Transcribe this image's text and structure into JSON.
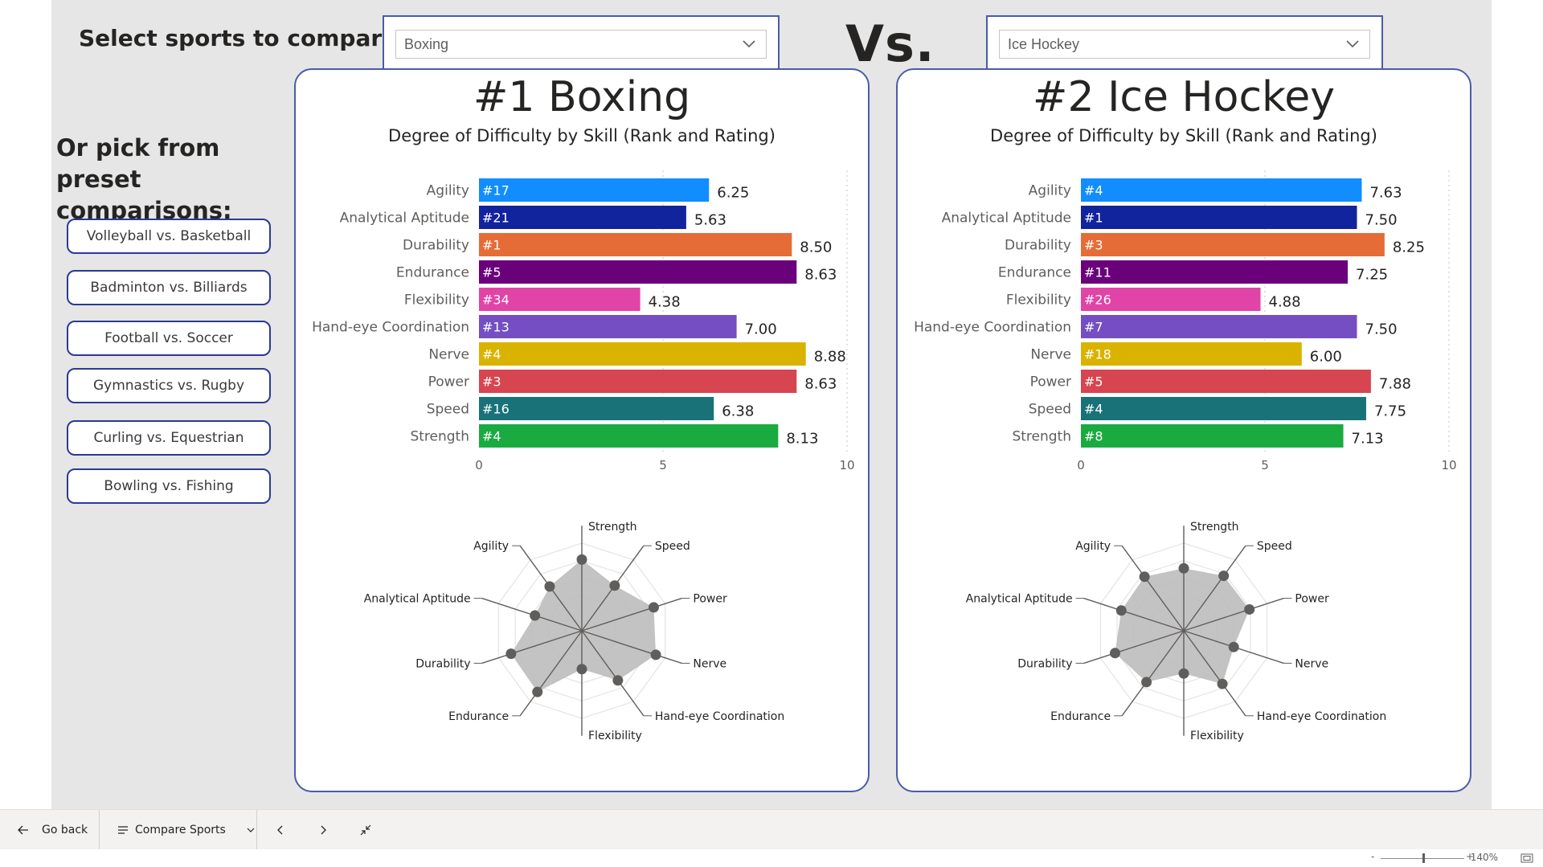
{
  "header": {
    "select_title": "Select sports to compare:",
    "vs_label": "Vs.",
    "preset_title": "Or pick from preset comparisons:"
  },
  "dropdowns": {
    "left": {
      "value": "Boxing",
      "icon": "chevron-down-icon"
    },
    "right": {
      "value": "Ice Hockey",
      "icon": "chevron-down-icon"
    }
  },
  "presets": [
    "Volleyball vs. Basketball",
    "Badminton vs. Billiards",
    "Football vs. Soccer",
    "Gymnastics vs. Rugby",
    "Curling vs. Equestrian",
    "Bowling vs. Fishing"
  ],
  "colors": {
    "Agility": "#118dff",
    "Analytical Aptitude": "#12239e",
    "Durability": "#e66c37",
    "Endurance": "#6b007b",
    "Flexibility": "#e044a7",
    "Hand-eye Coordination": "#744ec2",
    "Nerve": "#d9b300",
    "Power": "#d64550",
    "Speed": "#197278",
    "Strength": "#1aab40",
    "accent_border": "#4a5ca8",
    "preset_border": "#2b3a93",
    "radar_fill": "#bdbdbd",
    "radar_point": "#605e5c"
  },
  "cards": [
    {
      "title": "#1 Boxing",
      "subtitle": "Degree of Difficulty by Skill (Rank and Rating)"
    },
    {
      "title": "#2 Ice Hockey",
      "subtitle": "Degree of Difficulty by Skill (Rank and Rating)"
    }
  ],
  "chart_data": [
    {
      "type": "bar",
      "title": "Degree of Difficulty by Skill (Rank and Rating)",
      "categories": [
        "Agility",
        "Analytical Aptitude",
        "Durability",
        "Endurance",
        "Flexibility",
        "Hand-eye Coordination",
        "Nerve",
        "Power",
        "Speed",
        "Strength"
      ],
      "values": [
        6.25,
        5.63,
        8.5,
        8.63,
        4.38,
        7.0,
        8.88,
        8.63,
        6.38,
        8.13
      ],
      "value_labels": [
        "6.25",
        "5.63",
        "8.50",
        "8.63",
        "4.38",
        "7.00",
        "8.88",
        "8.63",
        "6.38",
        "8.13"
      ],
      "ranks": [
        "#17",
        "#21",
        "#1",
        "#5",
        "#34",
        "#13",
        "#4",
        "#3",
        "#16",
        "#4"
      ],
      "xlim": [
        0,
        10
      ],
      "xticks": [
        "0",
        "5",
        "10"
      ],
      "grid": true
    },
    {
      "type": "radar",
      "axes": [
        "Strength",
        "Speed",
        "Power",
        "Nerve",
        "Hand-eye Coordination",
        "Flexibility",
        "Endurance",
        "Durability",
        "Analytical Aptitude",
        "Agility"
      ],
      "values": [
        8.13,
        6.38,
        8.63,
        8.88,
        7.0,
        4.38,
        8.63,
        8.5,
        5.63,
        6.25
      ],
      "rlim": [
        0,
        10
      ]
    },
    {
      "type": "bar",
      "title": "Degree of Difficulty by Skill (Rank and Rating)",
      "categories": [
        "Agility",
        "Analytical Aptitude",
        "Durability",
        "Endurance",
        "Flexibility",
        "Hand-eye Coordination",
        "Nerve",
        "Power",
        "Speed",
        "Strength"
      ],
      "values": [
        7.63,
        7.5,
        8.25,
        7.25,
        4.88,
        7.5,
        6.0,
        7.88,
        7.75,
        7.13
      ],
      "value_labels": [
        "7.63",
        "7.50",
        "8.25",
        "7.25",
        "4.88",
        "7.50",
        "6.00",
        "7.88",
        "7.75",
        "7.13"
      ],
      "ranks": [
        "#4",
        "#1",
        "#3",
        "#11",
        "#26",
        "#7",
        "#18",
        "#5",
        "#4",
        "#8"
      ],
      "xlim": [
        0,
        10
      ],
      "xticks": [
        "0",
        "5",
        "10"
      ],
      "grid": true
    },
    {
      "type": "radar",
      "axes": [
        "Strength",
        "Speed",
        "Power",
        "Nerve",
        "Hand-eye Coordination",
        "Flexibility",
        "Endurance",
        "Durability",
        "Analytical Aptitude",
        "Agility"
      ],
      "values": [
        7.13,
        7.75,
        7.88,
        6.0,
        7.5,
        4.88,
        7.25,
        8.25,
        7.5,
        7.63
      ],
      "rlim": [
        0,
        10
      ]
    }
  ],
  "taskbar": {
    "back_label": "Go back",
    "back_icon": "arrow-left-icon",
    "page_label": "Compare Sports",
    "page_icon": "menu-lines-icon",
    "chevron_icon": "chevron-down-icon",
    "prev_icon": "chevron-left-icon",
    "next_icon": "chevron-right-icon",
    "collapse_icon": "collapse-arrows-icon"
  },
  "status": {
    "zoom_label": "140%",
    "zoom_minus": "-",
    "zoom_plus": "+",
    "fit_icon": "fit-screen-icon"
  }
}
